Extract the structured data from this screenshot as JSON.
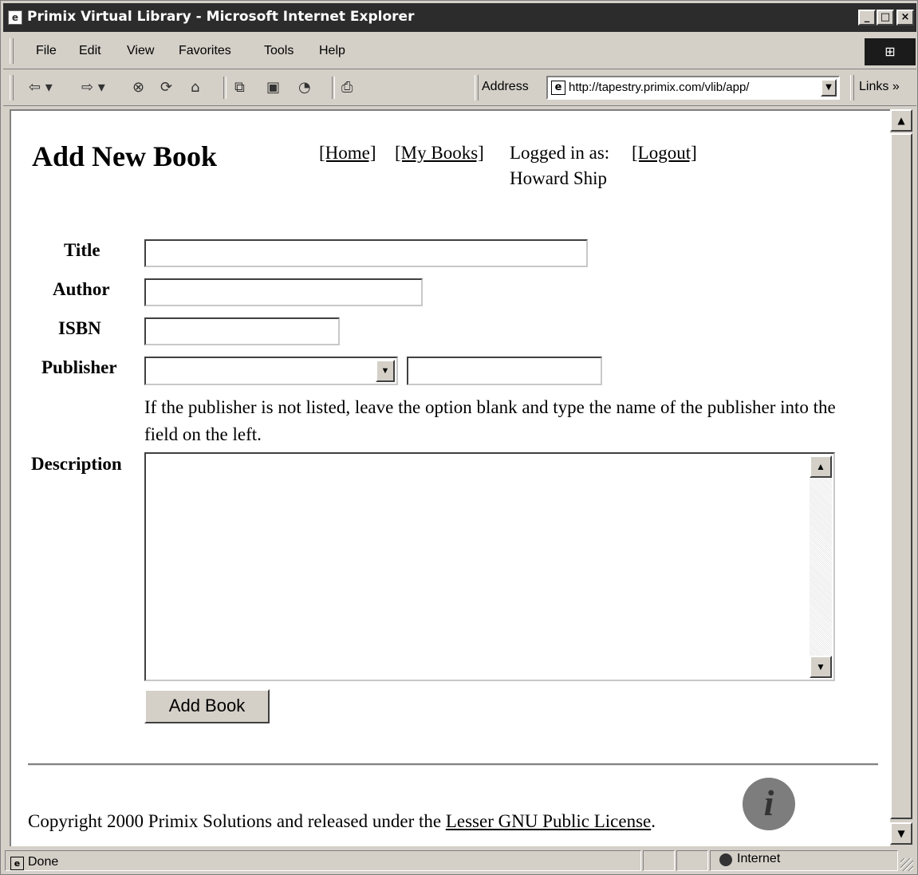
{
  "window": {
    "title": "Primix Virtual Library - Microsoft Internet Explorer",
    "minimize": "_",
    "maximize": "□",
    "close": "×"
  },
  "menu": {
    "items": [
      "File",
      "Edit",
      "View",
      "Favorites",
      "Tools",
      "Help"
    ]
  },
  "toolbar": {
    "address_label": "Address",
    "address_url": "http://tapestry.primix.com/vlib/app/",
    "links_label": "Links",
    "links_chevron": "»"
  },
  "page": {
    "title": "Add New Book",
    "nav_home": "[Home]",
    "nav_my_books": "[My Books]",
    "logged_in_label": "Logged in as:",
    "logged_in_user": "Howard Ship",
    "nav_logout": "[Logout]",
    "form": {
      "title_label": "Title",
      "title_value": "",
      "author_label": "Author",
      "author_value": "",
      "isbn_label": "ISBN",
      "isbn_value": "",
      "publisher_label": "Publisher",
      "publisher_selected": "",
      "publisher_text": "",
      "publisher_hint": "If the publisher is not listed, leave the option blank and type the name of the publisher into the field on the left.",
      "description_label": "Description",
      "description_value": "",
      "submit_label": "Add Book"
    },
    "footer": {
      "copyright_prefix": "Copyright 2000 Primix Solutions and released under the ",
      "license_link": "Lesser GNU Public License",
      "copyright_suffix": "."
    }
  },
  "statusbar": {
    "status": "Done",
    "zone": "Internet"
  },
  "icons": [
    "ie-logo-icon",
    "back-icon",
    "forward-icon",
    "stop-icon",
    "refresh-icon",
    "home-icon",
    "search-icon",
    "favorites-icon",
    "history-icon",
    "print-icon",
    "info-icon",
    "internet-zone-icon"
  ]
}
